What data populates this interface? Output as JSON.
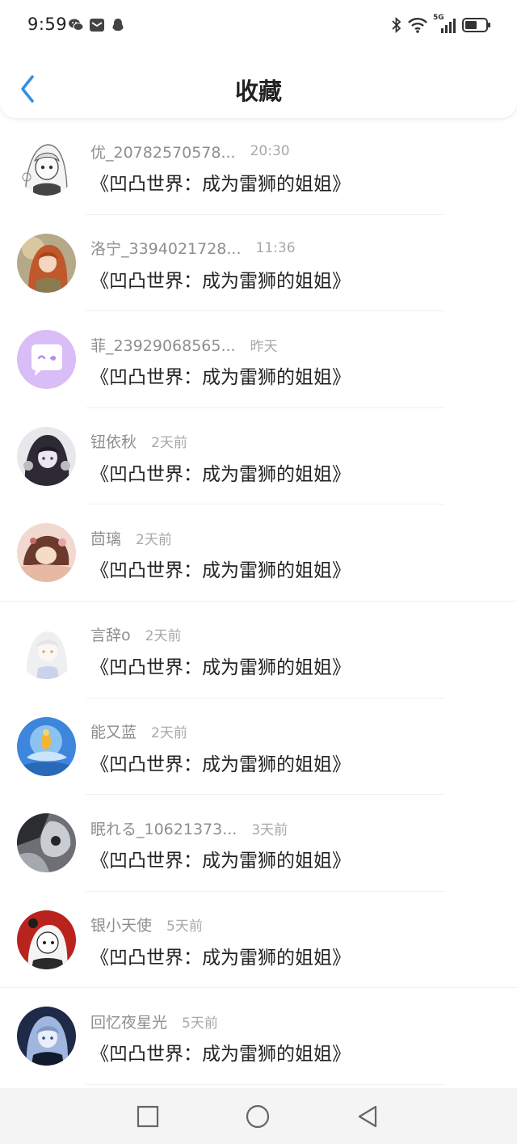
{
  "status_bar": {
    "time": "9:59",
    "left_icons": [
      "wechat-icon",
      "mail-icon",
      "qq-icon"
    ],
    "right_icons": [
      "bluetooth-icon",
      "wifi-icon",
      "signal-5g-icon",
      "battery-icon"
    ],
    "network_label": "5G"
  },
  "header": {
    "title": "收藏",
    "back_icon": "chevron-left-icon",
    "accent_color": "#2f8ee6"
  },
  "items": [
    {
      "name": "优_20782570578...",
      "time": "20:30",
      "content": "《凹凸世界：成为雷狮的姐姐》",
      "avatar": "avatar-sketch"
    },
    {
      "name": "洛宁_3394021728...",
      "time": "11:36",
      "content": "《凹凸世界：成为雷狮的姐姐》",
      "avatar": "avatar-orange"
    },
    {
      "name": "菲_23929068565...",
      "time": "昨天",
      "content": "《凹凸世界：成为雷狮的姐姐》",
      "avatar": "avatar-default-purple"
    },
    {
      "name": "钮依秋",
      "time": "2天前",
      "content": "《凹凸世界：成为雷狮的姐姐》",
      "avatar": "avatar-dark"
    },
    {
      "name": "茴璃",
      "time": "2天前",
      "content": "《凹凸世界：成为雷狮的姐姐》",
      "avatar": "avatar-pink"
    },
    {
      "name": "言辞o",
      "time": "2天前",
      "content": "《凹凸世界：成为雷狮的姐姐》",
      "avatar": "avatar-white"
    },
    {
      "name": "能又蓝",
      "time": "2天前",
      "content": "《凹凸世界：成为雷狮的姐姐》",
      "avatar": "avatar-blue"
    },
    {
      "name": "眠れる_10621373...",
      "time": "3天前",
      "content": "《凹凸世界：成为雷狮的姐姐》",
      "avatar": "avatar-gray"
    },
    {
      "name": "银小天使",
      "time": "5天前",
      "content": "《凹凸世界：成为雷狮的姐姐》",
      "avatar": "avatar-red"
    },
    {
      "name": "回忆夜星光",
      "time": "5天前",
      "content": "《凹凸世界：成为雷狮的姐姐》",
      "avatar": "avatar-navy"
    }
  ],
  "nav_bar": {
    "buttons": [
      "square-recents-icon",
      "circle-home-icon",
      "triangle-back-icon"
    ]
  }
}
